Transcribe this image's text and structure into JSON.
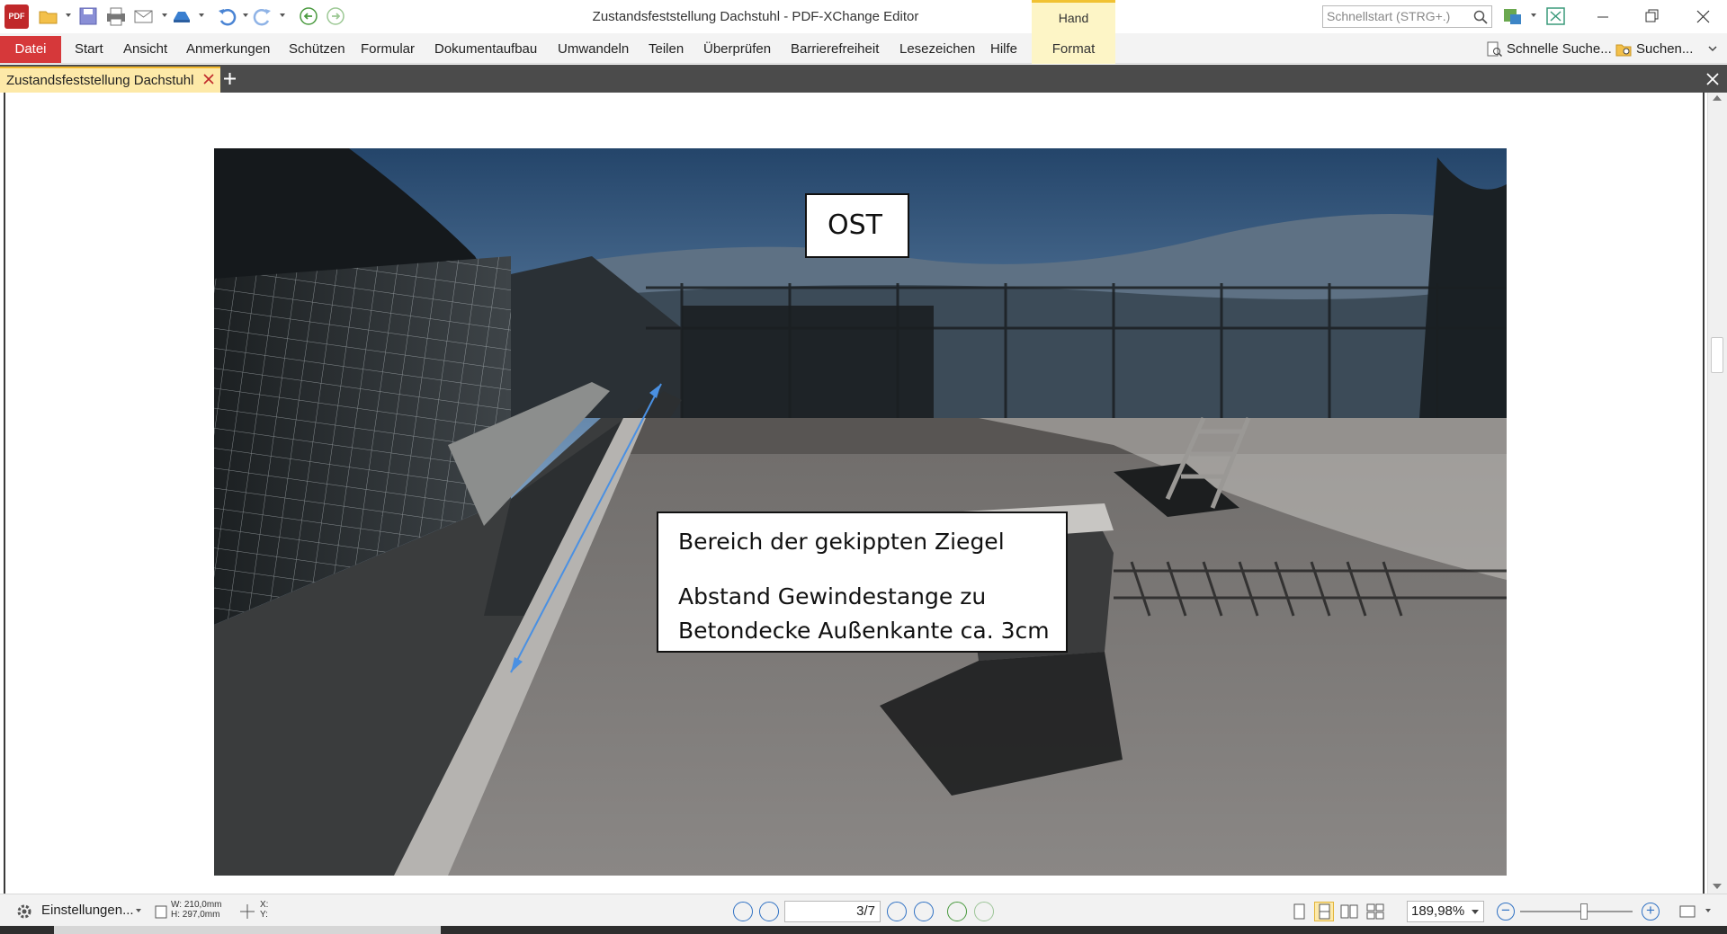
{
  "app": {
    "title": "Zustandsfeststellung Dachstuhl - PDF-XChange Editor",
    "logo_text": "PDF"
  },
  "quick_access": {
    "icons": [
      "open-folder-icon",
      "save-icon",
      "print-icon",
      "email-icon",
      "scan-icon",
      "undo-icon",
      "redo-icon",
      "back-icon",
      "forward-icon"
    ]
  },
  "contextual_tab": {
    "group_label": "Hand",
    "tab_label": "Format"
  },
  "search": {
    "placeholder": "Schnellstart (STRG+.)"
  },
  "menu": {
    "file": "Datei",
    "items": [
      "Start",
      "Ansicht",
      "Anmerkungen",
      "Schützen",
      "Formular",
      "Dokumentaufbau",
      "Umwandeln",
      "Teilen",
      "Überprüfen",
      "Barrierefreiheit",
      "Lesezeichen",
      "Hilfe"
    ],
    "quick_find": "Schnelle Suche...",
    "find": "Suchen..."
  },
  "document_tab": {
    "label": "Zustandsfeststellung Dachstuhl"
  },
  "annotations": {
    "ost": "OST",
    "info_line1": "Bereich der gekippten Ziegel",
    "info_line2": "Abstand Gewindestange zu",
    "info_line3": "Betondecke Außenkante ca. 3cm",
    "arrow_color": "#4a90e2"
  },
  "statusbar": {
    "settings": "Einstellungen...",
    "page_width": "W: 210,0mm",
    "page_height": "H: 297,0mm",
    "cursor_x": "X:",
    "cursor_y": "Y:",
    "page_current": "3",
    "page_total": "/7",
    "zoom": "189,98%"
  },
  "colors": {
    "accent_red": "#d6383a",
    "tab_yellow": "#fde9a8",
    "nav_blue": "#3273c4",
    "nav_green": "#4a9a3f"
  }
}
